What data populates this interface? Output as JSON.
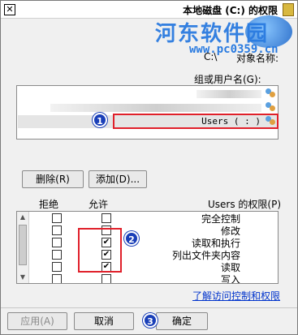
{
  "window": {
    "title": "本地磁盘 (C:) 的权限",
    "close_glyph": "✕"
  },
  "watermark": {
    "brand": "河东软件园",
    "url": "www.pc0359.cn"
  },
  "object": {
    "label": "对象名称:",
    "value": "C:\\"
  },
  "groups": {
    "label": "组或用户名(G):",
    "items": [
      {
        "label": ""
      },
      {
        "label": ""
      },
      {
        "label": "Users (   :   )",
        "selected": true
      }
    ]
  },
  "buttons": {
    "add": "添加(D)...",
    "remove": "删除(R)",
    "ok": "确定",
    "cancel": "取消",
    "apply": "应用(A)"
  },
  "permissions": {
    "header_label": "Users 的权限(P)",
    "allow_label": "允许",
    "deny_label": "拒绝",
    "rows": [
      {
        "name": "完全控制",
        "allow": false,
        "deny": false
      },
      {
        "name": "修改",
        "allow": false,
        "deny": false
      },
      {
        "name": "读取和执行",
        "allow": true,
        "deny": false
      },
      {
        "name": "列出文件夹内容",
        "allow": true,
        "deny": false
      },
      {
        "name": "读取",
        "allow": true,
        "deny": false
      },
      {
        "name": "写入",
        "allow": false,
        "deny": false
      }
    ]
  },
  "link_text": "了解访问控制和权限",
  "badges": [
    "1",
    "2",
    "3"
  ],
  "colors": {
    "highlight_box": "#e0202a",
    "badge": "#1a3fb8",
    "link": "#0033cc"
  }
}
